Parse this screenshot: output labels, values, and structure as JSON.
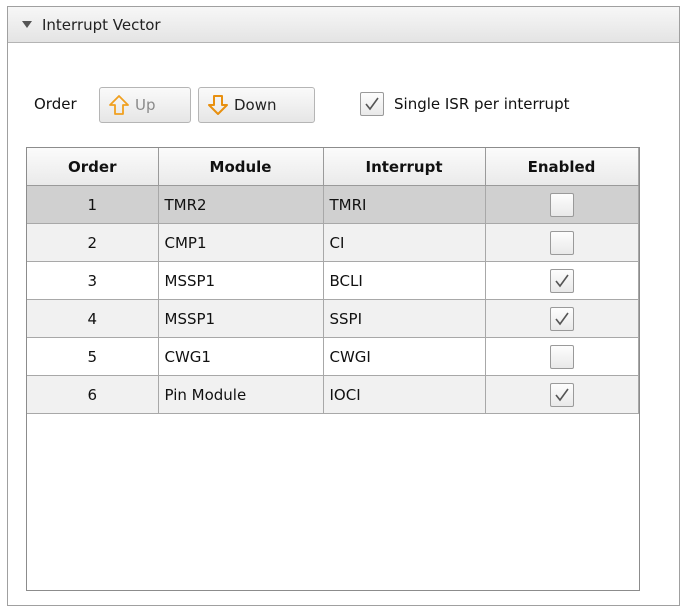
{
  "panel": {
    "title": "Interrupt Vector",
    "toolbar": {
      "order_label": "Order",
      "up_label": "Up",
      "down_label": "Down",
      "single_isr_label": "Single ISR per interrupt",
      "single_isr_checked": true
    }
  },
  "table": {
    "columns": [
      "Order",
      "Module",
      "Interrupt",
      "Enabled"
    ],
    "rows": [
      {
        "order": "1",
        "module": "TMR2",
        "interrupt": "TMRI",
        "enabled": false,
        "selected": true
      },
      {
        "order": "2",
        "module": "CMP1",
        "interrupt": "CI",
        "enabled": false
      },
      {
        "order": "3",
        "module": "MSSP1",
        "interrupt": "BCLI",
        "enabled": true
      },
      {
        "order": "4",
        "module": "MSSP1",
        "interrupt": "SSPI",
        "enabled": true
      },
      {
        "order": "5",
        "module": "CWG1",
        "interrupt": "CWGI",
        "enabled": false
      },
      {
        "order": "6",
        "module": "Pin Module",
        "interrupt": "IOCI",
        "enabled": true
      }
    ]
  },
  "colors": {
    "arrow_orange": "#f0a020",
    "selected_row": "#d0d0d0",
    "alt_row": "#f1f1f1"
  }
}
